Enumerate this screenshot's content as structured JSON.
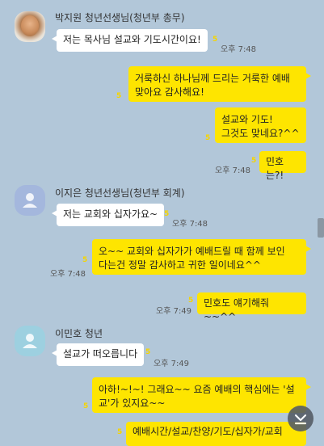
{
  "messages": {
    "m1": {
      "sender": "박지원 청년선생님(청년부 총무)",
      "text": "저는 목사님 설교와 기도시간이요!",
      "time": "오후 7:48",
      "unread": "5"
    },
    "m2": {
      "text": "거룩하신 하나님께 드리는 거룩한 예배\n맞아요 감사해요!",
      "unread": "5"
    },
    "m3": {
      "text": "설교와 기도!\n그것도 맞네요?^^",
      "unread": "5"
    },
    "m4": {
      "text": "민호는?!",
      "time": "오후 7:48",
      "unread": "5"
    },
    "m5": {
      "sender": "이지은 청년선생님(청년부 회계)",
      "text": "저는 교회와 십자가요~",
      "time": "오후 7:48",
      "unread": "5"
    },
    "m6": {
      "text": "오~~ 교회와 십자가가 예배드릴 때 함께 보인\n다는건 정말 감사하고 귀한 일이네요^^",
      "time": "오후 7:48",
      "unread": "5"
    },
    "m7": {
      "text": "민호도 얘기해줘~~^^",
      "time": "오후 7:49",
      "unread": "5"
    },
    "m8": {
      "sender": "이민호 청년",
      "text": "설교가 떠오릅니다",
      "time": "오후 7:49",
      "unread": "5"
    },
    "m9": {
      "text": "아하!~!~! 그래요~~ 요즘 예배의 핵심에는 '설\n교'가 있지요~~",
      "unread": "5"
    },
    "m10": {
      "text": "예배시간/설교/찬양/기도/십자가/교회",
      "unread": "5"
    }
  }
}
